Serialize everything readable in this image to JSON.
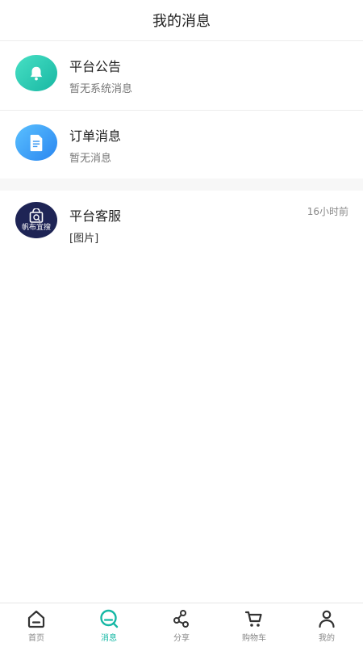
{
  "header": {
    "title": "我的消息"
  },
  "system_messages": [
    {
      "title": "平台公告",
      "subtitle": "暂无系统消息",
      "icon": "bell-icon"
    },
    {
      "title": "订单消息",
      "subtitle": "暂无消息",
      "icon": "document-icon"
    }
  ],
  "chats": [
    {
      "title": "平台客服",
      "preview": "[图片]",
      "time": "16小时前",
      "brand": "帆布宜搜"
    }
  ],
  "tabbar": [
    {
      "label": "首页",
      "icon": "home-icon"
    },
    {
      "label": "消息",
      "icon": "message-icon",
      "active": true
    },
    {
      "label": "分享",
      "icon": "share-icon"
    },
    {
      "label": "购物车",
      "icon": "cart-icon"
    },
    {
      "label": "我的",
      "icon": "user-icon"
    }
  ],
  "colors": {
    "accent": "#16b8a5",
    "bell_bg": "#1fbfa8",
    "doc_bg": "#3a98f3",
    "brand_bg": "#1e2455"
  }
}
